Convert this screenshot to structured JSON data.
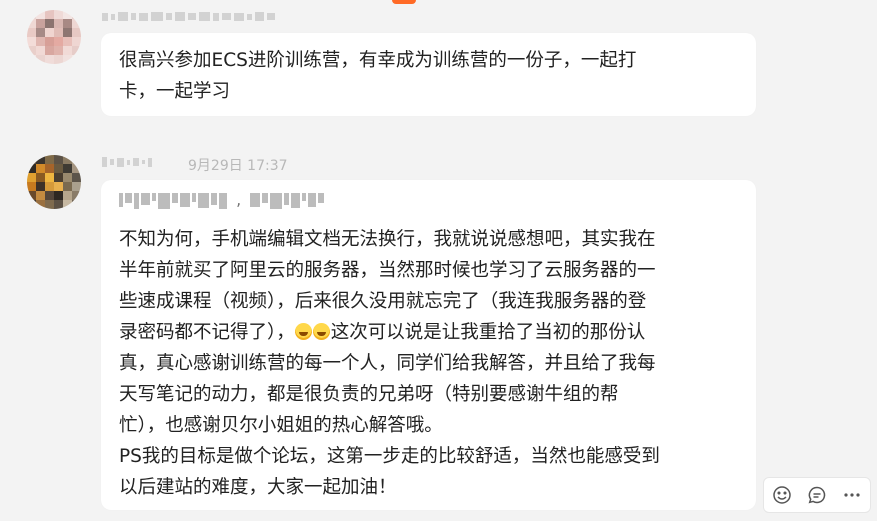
{
  "messages": [
    {
      "author_redacted": true,
      "timestamp": "",
      "text": "很高兴参加ECS进阶训练营，有幸成为训练营的一份子，一起打\n卡，一起学习"
    },
    {
      "author_redacted": true,
      "timestamp": "9月29日 17:37",
      "text_before_emoji": "不知为何，手机端编辑文档无法换行，我就说说感想吧，其实我在\n半年前就买了阿里云的服务器，当然那时候也学习了云服务器的一\n些速成课程（视频），后来很久没用就忘完了（我连我服务器的登\n录密码都不记得了），",
      "emoji": [
        "smile-emoji",
        "smile-emoji"
      ],
      "text_after_emoji": "这次可以说是让我重拾了当初的那份认\n真，真心感谢训练营的每一个人，同学们给我解答，并且给了我每\n天写笔记的动力，都是很负责的兄弟呀（特别要感谢牛组的帮\n忙），也感谢贝尔小姐姐的热心解答哦。\nPS我的目标是做个论坛，这第一步走的比较舒适，当然也能感受到\n以后建站的难度，大家一起加油！"
    }
  ],
  "actions": {
    "icons": [
      "emoji-reaction-icon",
      "comment-icon",
      "more-icon"
    ]
  },
  "colors": {
    "background": "#f3f3f3",
    "bubble": "#ffffff",
    "meta": "#b8b8b8",
    "accent_mark": "#ff6a26"
  }
}
